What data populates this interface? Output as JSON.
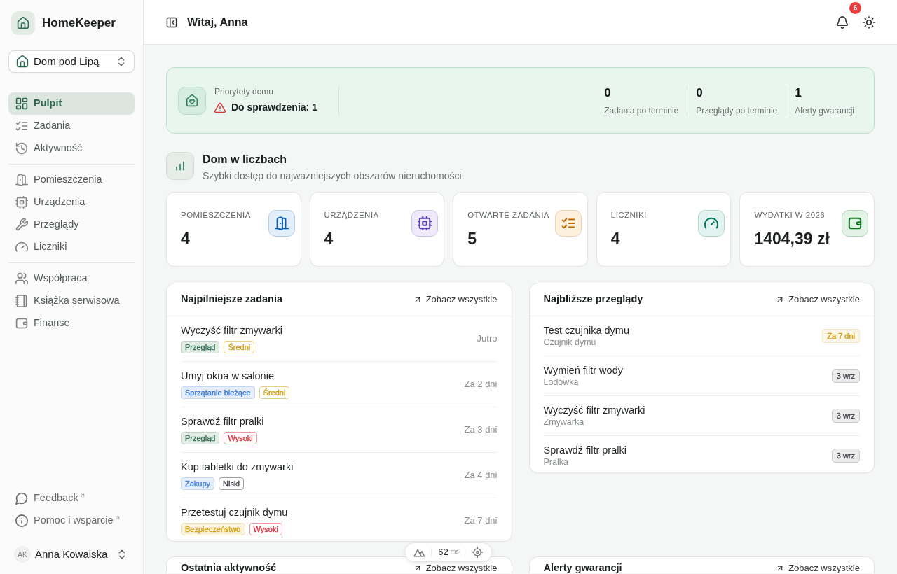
{
  "sidebar": {
    "app_name": "HomeKeeper",
    "home_selector": {
      "value": "Dom pod Lipą"
    },
    "nav_groups": [
      {
        "items": [
          {
            "label": "Pulpit",
            "selected": true
          },
          {
            "label": "Zadania",
            "selected": false
          },
          {
            "label": "Aktywność",
            "selected": false
          }
        ]
      },
      {
        "items": [
          {
            "label": "Pomieszczenia",
            "selected": false
          },
          {
            "label": "Urządzenia",
            "selected": false
          },
          {
            "label": "Przeglądy",
            "selected": false
          },
          {
            "label": "Liczniki",
            "selected": false
          }
        ]
      },
      {
        "items": [
          {
            "label": "Współpraca",
            "selected": false
          },
          {
            "label": "Książka serwisowa",
            "selected": false
          },
          {
            "label": "Finanse",
            "selected": false
          }
        ]
      }
    ],
    "footer_links": [
      {
        "label": "Feedback"
      },
      {
        "label": "Pomoc i wsparcie"
      }
    ],
    "user": {
      "initials": "AK",
      "name": "Anna Kowalska"
    }
  },
  "header": {
    "greeting": "Witaj, Anna",
    "notification_count": "6"
  },
  "priority_banner": {
    "title": "Priorytety domu",
    "status": "Do sprawdzenia: 1",
    "stats": [
      {
        "value": "0",
        "label": "Zadania po terminie"
      },
      {
        "value": "0",
        "label": "Przeglądy po terminie"
      },
      {
        "value": "1",
        "label": "Alerty gwarancji"
      }
    ]
  },
  "overview": {
    "title": "Dom w liczbach",
    "subtitle": "Szybki dostęp do najważniejszych obszarów nieruchomości.",
    "cards": [
      {
        "label": "POMIESZCZENIA",
        "value": "4",
        "color": "#e2eefa"
      },
      {
        "label": "URZĄDZENIA",
        "value": "4",
        "color": "#eeeafb"
      },
      {
        "label": "OTWARTE ZADANIA",
        "value": "5",
        "color": "#fdf0dc"
      },
      {
        "label": "LICZNIKI",
        "value": "4",
        "color": "#e1f2ef"
      },
      {
        "label": "WYDATKI W 2026",
        "value": "1404,39 zł",
        "color": "#e2f2e5"
      }
    ]
  },
  "urgent_tasks": {
    "title": "Najpilniejsze zadania",
    "link": "Zobacz wszystkie",
    "items": [
      {
        "title": "Wyczyść filtr zmywarki",
        "due": "Jutro",
        "tags": [
          {
            "label": "Przegląd",
            "kind": "category",
            "color": "#2f6f4f"
          },
          {
            "label": "Średni",
            "kind": "priority",
            "color": "#d4a00a"
          }
        ]
      },
      {
        "title": "Umyj okna w salonie",
        "due": "Za 2 dni",
        "tags": [
          {
            "label": "Sprzątanie bieżące",
            "kind": "category",
            "color": "#3b7bd8"
          },
          {
            "label": "Średni",
            "kind": "priority",
            "color": "#d4a00a"
          }
        ]
      },
      {
        "title": "Sprawdź filtr pralki",
        "due": "Za 3 dni",
        "tags": [
          {
            "label": "Przegląd",
            "kind": "category",
            "color": "#2f6f4f"
          },
          {
            "label": "Wysoki",
            "kind": "priority",
            "color": "#dc2f3c"
          }
        ]
      },
      {
        "title": "Kup tabletki do zmywarki",
        "due": "Za 4 dni",
        "tags": [
          {
            "label": "Zakupy",
            "kind": "category",
            "color": "#3b7bd8"
          },
          {
            "label": "Niski",
            "kind": "priority",
            "color": "#3f3f46"
          }
        ]
      },
      {
        "title": "Przetestuj czujnik dymu",
        "due": "Za 7 dni",
        "tags": [
          {
            "label": "Bezpieczeństwo",
            "kind": "category",
            "color": "#d4a00a"
          },
          {
            "label": "Wysoki",
            "kind": "priority",
            "color": "#dc2f3c"
          }
        ]
      }
    ]
  },
  "upcoming_inspections": {
    "title": "Najbliższe przeglądy",
    "link": "Zobacz wszystkie",
    "items": [
      {
        "title": "Test czujnika dymu",
        "subtitle": "Czujnik dymu",
        "due": "Za 7 dni",
        "color": "#d4a00a"
      },
      {
        "title": "Wymień filtr wody",
        "subtitle": "Lodówka",
        "due": "3 wrz",
        "color": "#3f3f46"
      },
      {
        "title": "Wyczyść filtr zmywarki",
        "subtitle": "Zmywarka",
        "due": "3 wrz",
        "color": "#3f3f46"
      },
      {
        "title": "Sprawdź filtr pralki",
        "subtitle": "Pralka",
        "due": "3 wrz",
        "color": "#3f3f46"
      }
    ]
  },
  "recent_activity": {
    "title": "Ostatnia aktywność",
    "link": "Zobacz wszystkie"
  },
  "warranty_alerts": {
    "title": "Alerty gwarancji",
    "link": "Zobacz wszystkie"
  },
  "dev_toolbar": {
    "timing": "62",
    "unit": "ms"
  }
}
